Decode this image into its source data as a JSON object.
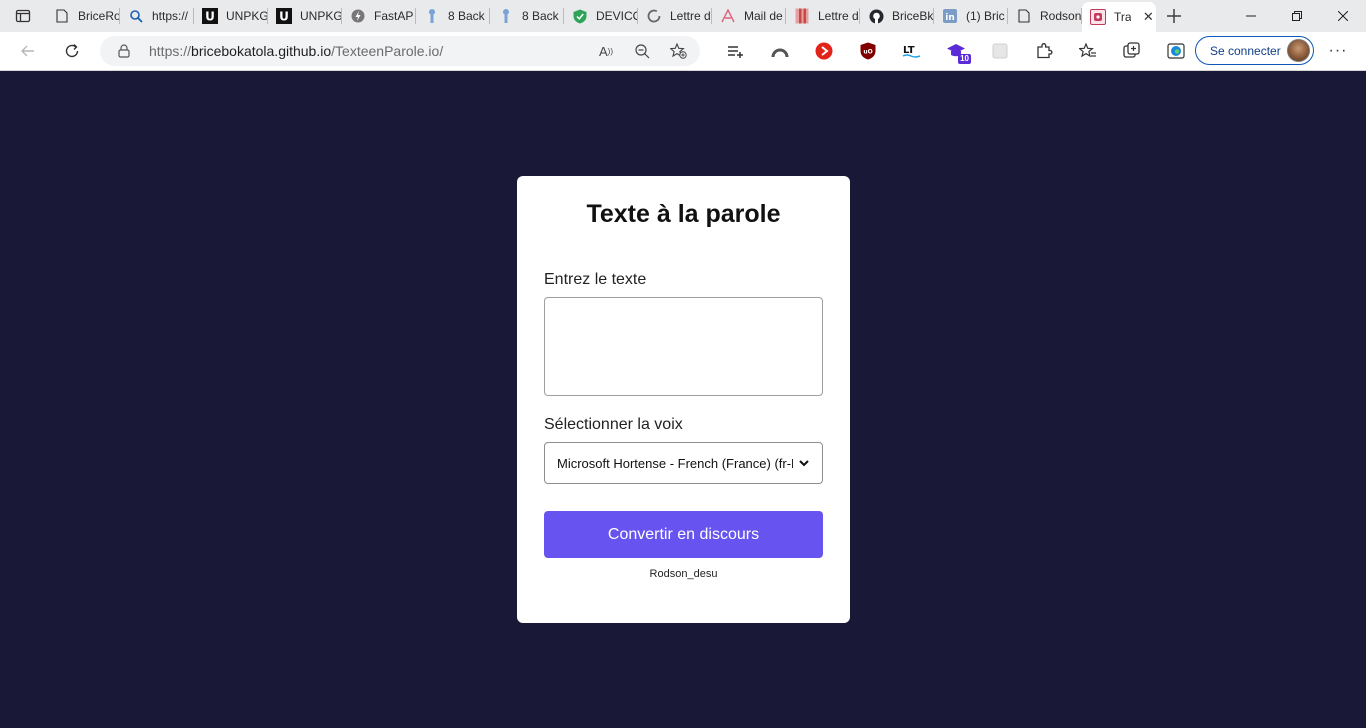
{
  "browser": {
    "tabs": [
      {
        "title": "BriceRo",
        "icon": "page-icon",
        "width": 74
      },
      {
        "title": "https://",
        "icon": "search-icon",
        "width": 74
      },
      {
        "title": "UNPKG",
        "icon": "unpkg-icon",
        "width": 74
      },
      {
        "title": "UNPKG",
        "icon": "unpkg-icon",
        "width": 74
      },
      {
        "title": "FastAP",
        "icon": "fastapi-icon",
        "width": 74
      },
      {
        "title": "8 Back",
        "icon": "info-icon",
        "width": 74
      },
      {
        "title": "8 Back",
        "icon": "info-icon",
        "width": 74
      },
      {
        "title": "DEVICO",
        "icon": "shield-icon",
        "width": 74
      },
      {
        "title": "Lettre d",
        "icon": "loading-icon",
        "width": 74
      },
      {
        "title": "Mail de",
        "icon": "a-logo-icon",
        "width": 74
      },
      {
        "title": "Lettre d",
        "icon": "book-icon",
        "width": 74
      },
      {
        "title": "BriceBk",
        "icon": "github-icon",
        "width": 74
      },
      {
        "title": "(1) Bric",
        "icon": "linkedin-icon",
        "width": 74
      },
      {
        "title": "Rodson",
        "icon": "page-icon",
        "width": 74
      }
    ],
    "active_tab": {
      "title": "Tra",
      "icon": "app-icon"
    },
    "address": {
      "prefix": "https://",
      "host": "bricebokatola.github.io",
      "path": "/TexteenParole.io/"
    },
    "signin_label": "Se connecter",
    "extension_badge": "10",
    "colors": {
      "accent": "#0f58b8",
      "tabbar": "#e9eaec"
    }
  },
  "page": {
    "background": "#191937",
    "title": "Texte à la parole",
    "text_label": "Entrez le texte",
    "text_value": "",
    "voice_label": "Sélectionner la voix",
    "voice_selected": "Microsoft Hortense - French (France) (fr-FR)",
    "convert_label": "Convertir en discours",
    "credit": "Rodson_desu",
    "button_color": "#6653f0"
  }
}
